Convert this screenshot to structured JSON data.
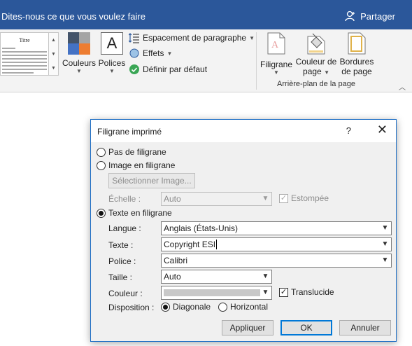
{
  "titlebar": {
    "tell_me": "Dites-nous ce que vous voulez faire",
    "share": "Partager",
    "color": "#2b579a"
  },
  "ribbon": {
    "gallery_title": "Titre",
    "colors_label": "Couleurs",
    "fonts_label": "Polices",
    "fonts_icon_glyph": "A",
    "paragraph_spacing": "Espacement de paragraphe",
    "effects": "Effets",
    "set_default": "Définir par défaut",
    "watermark_label": "Filigrane",
    "page_color_label_1": "Couleur de",
    "page_color_label_2": "page",
    "page_borders_label_1": "Bordures",
    "page_borders_label_2": "de page",
    "group_label": "Arrière-plan de la page"
  },
  "dialog": {
    "title": "Filigrane imprimé",
    "help": "?",
    "no_watermark": "Pas de filigrane",
    "picture_watermark": "Image en filigrane",
    "select_picture": "Sélectionner Image...",
    "scale_label": "Échelle :",
    "scale_value": "Auto",
    "washout_label": "Estompée",
    "text_watermark": "Texte en filigrane",
    "language_label": "Langue :",
    "language_value": "Anglais (États-Unis)",
    "text_label": "Texte :",
    "text_value": "Copyright ESI",
    "font_label": "Police :",
    "font_value": "Calibri",
    "size_label": "Taille :",
    "size_value": "Auto",
    "color_label": "Couleur :",
    "semitransparent_label": "Translucide",
    "layout_label": "Disposition :",
    "diagonal_label": "Diagonale",
    "horizontal_label": "Horizontal",
    "apply_button": "Appliquer",
    "ok_button": "OK",
    "cancel_button": "Annuler"
  }
}
